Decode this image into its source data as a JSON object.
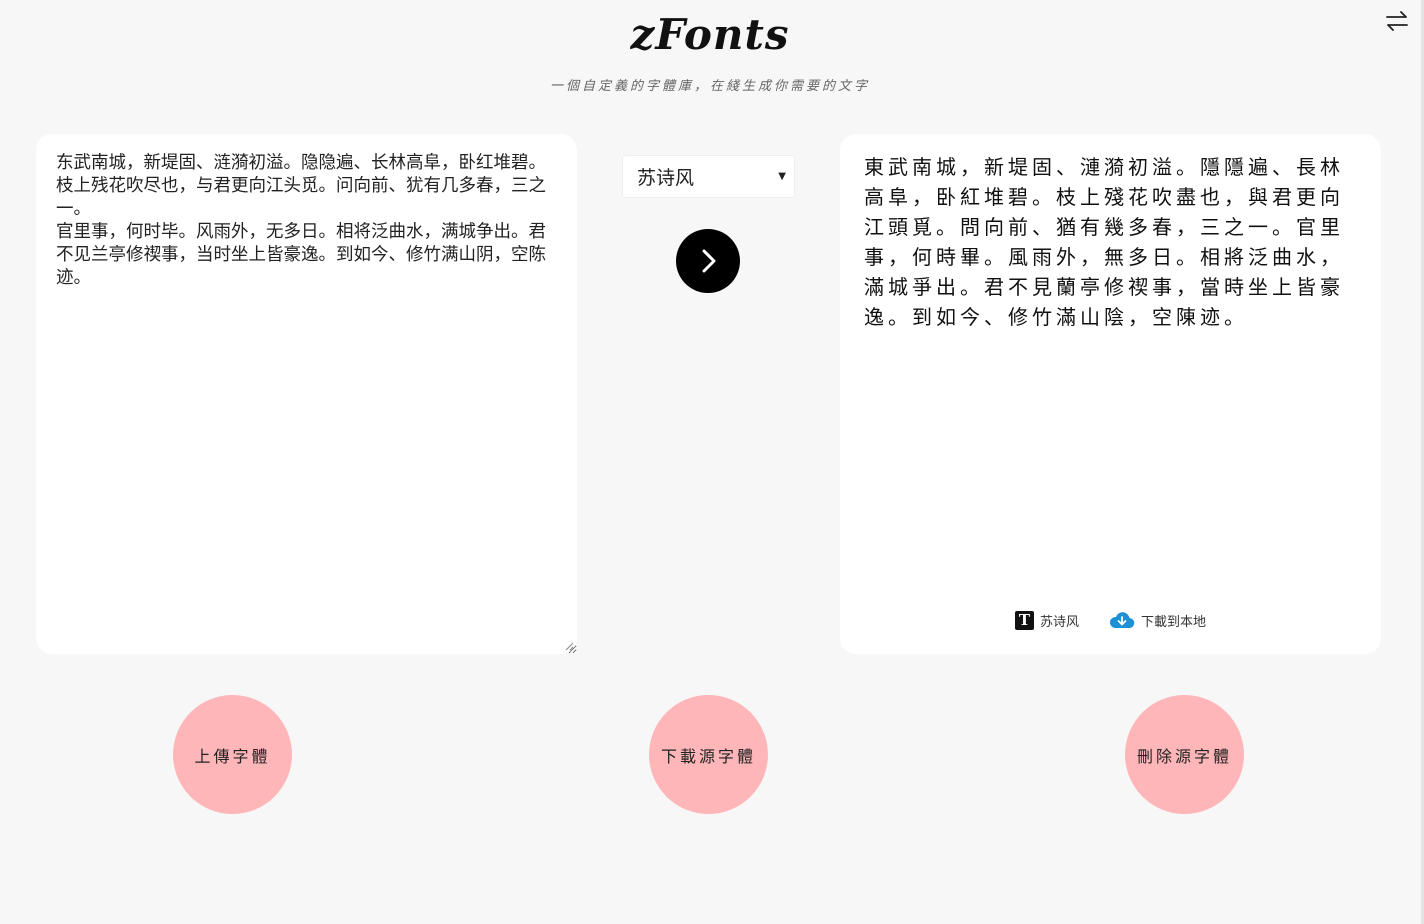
{
  "header": {
    "logo": "zFonts",
    "subtitle": "一個自定義的字體庫，在綫生成你需要的文字"
  },
  "editor": {
    "text": "东武南城，新堤固、涟漪初溢。隐隐遍、长林高阜，卧红堆碧。枝上残花吹尽也，与君更向江头觅。问向前、犹有几多春，三之一。\n官里事，何时毕。风雨外，无多日。相将泛曲水，满城争出。君不见兰亭修禊事，当时坐上皆豪逸。到如今、修竹满山阴，空陈迹。"
  },
  "font_select": {
    "selected": "苏诗风",
    "icon": "caret-down-icon"
  },
  "convert": {
    "icon": "chevron-right-icon"
  },
  "preview": {
    "text": "東武南城，新堤固、漣漪初溢。隱隱遍、長林高阜，卧紅堆碧。枝上殘花吹盡也，與君更向江頭覓。問向前、猶有幾多春，三之一。官里事，何時畢。風雨外，無多日。相將泛曲水，滿城爭出。君不見蘭亭修禊事，當時坐上皆豪逸。到如今、修竹滿山陰，空陳迹。",
    "font_label": "苏诗风",
    "font_icon_letter": "T",
    "download_label": "下載到本地",
    "download_icon": "cloud-download-icon",
    "download_icon_color": "#1e90d6"
  },
  "actions": {
    "upload_label": "上傳字體",
    "download_source_label": "下載源字體",
    "delete_source_label": "刪除源字體",
    "button_color": "#ffb6b9"
  },
  "toolbar": {
    "swap_icon": "swap-arrows-icon"
  }
}
